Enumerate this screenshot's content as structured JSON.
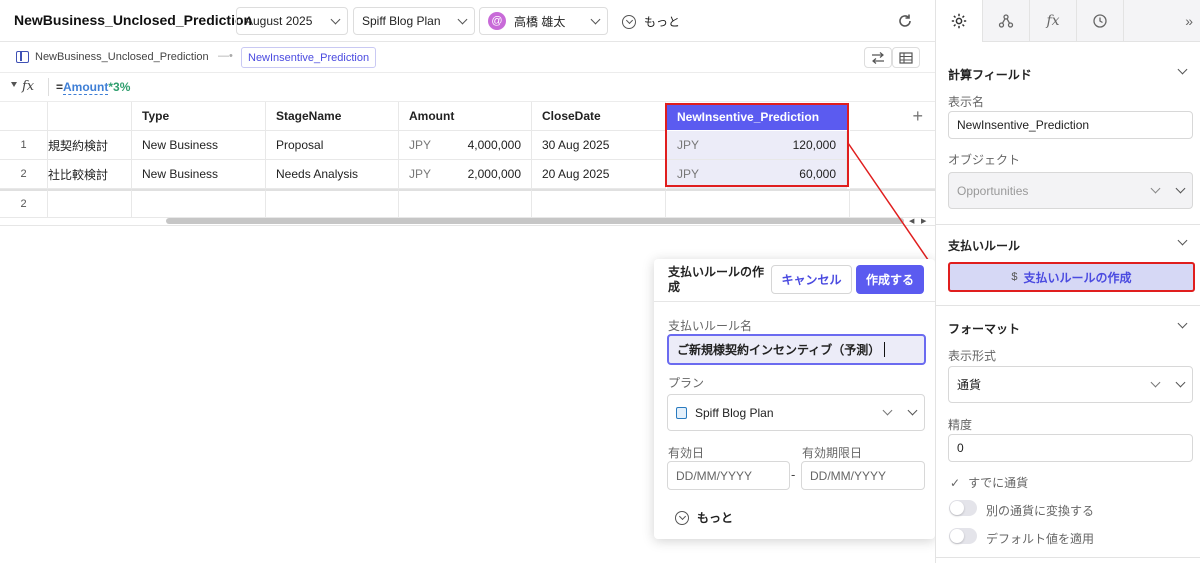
{
  "header": {
    "title": "NewBusiness_Unclosed_Prediction",
    "period": "August 2025",
    "plan": "Spiff Blog Plan",
    "user_initial": "@",
    "user": "高橋 雄太",
    "more": "もっと"
  },
  "breadcrumb": {
    "source": "NewBusiness_Unclosed_Prediction",
    "target": "NewInsentive_Prediction"
  },
  "formula": {
    "fx": "fx",
    "prefix": "=",
    "field": "Amount",
    "rest": "*3%"
  },
  "table": {
    "columns": [
      "Type",
      "StageName",
      "Amount",
      "CloseDate",
      "NewInsentive_Prediction"
    ],
    "rows": [
      {
        "num": "1",
        "name": "規契約検討",
        "type": "New Business",
        "stage": "Proposal",
        "currency": "JPY",
        "amount": "4,000,000",
        "close": "30 Aug 2025",
        "pred_currency": "JPY",
        "pred": "120,000"
      },
      {
        "num": "2",
        "name": "社比較検討",
        "type": "New Business",
        "stage": "Needs Analysis",
        "currency": "JPY",
        "amount": "2,000,000",
        "close": "20 Aug 2025",
        "pred_currency": "JPY",
        "pred": "60,000"
      }
    ],
    "footer_count": "2"
  },
  "panel": {
    "calc_title": "計算フィールド",
    "display_name_label": "表示名",
    "display_name_value": "NewInsentive_Prediction",
    "object_label": "オブジェクト",
    "object_value": "Opportunities",
    "payment_title": "支払いルール",
    "create_rule_icon": "$",
    "create_rule_label": "支払いルールの作成",
    "format_title": "フォーマット",
    "display_format_label": "表示形式",
    "display_format_value": "通貨",
    "precision_label": "精度",
    "precision_value": "0",
    "already_currency": "すでに通貨",
    "convert_label": "別の通貨に変換する",
    "default_label": "デフォルト値を適用"
  },
  "popup": {
    "title": "支払いルールの作成",
    "cancel": "キャンセル",
    "create": "作成する",
    "rule_name_label": "支払いルール名",
    "rule_name_value": "ご新規様契約インセンティブ（予測）",
    "plan_label": "プラン",
    "plan_value": "Spiff Blog Plan",
    "effective_label": "有効日",
    "expiry_label": "有効期限日",
    "date_placeholder": "DD/MM/YYYY",
    "date_separator": "-",
    "more": "もっと"
  },
  "colors": {
    "accent": "#5b5bf0",
    "highlight_red": "#e01e1e",
    "selected_cell_bg": "#ececf8",
    "rule_button_bg": "#d6d8f5"
  }
}
